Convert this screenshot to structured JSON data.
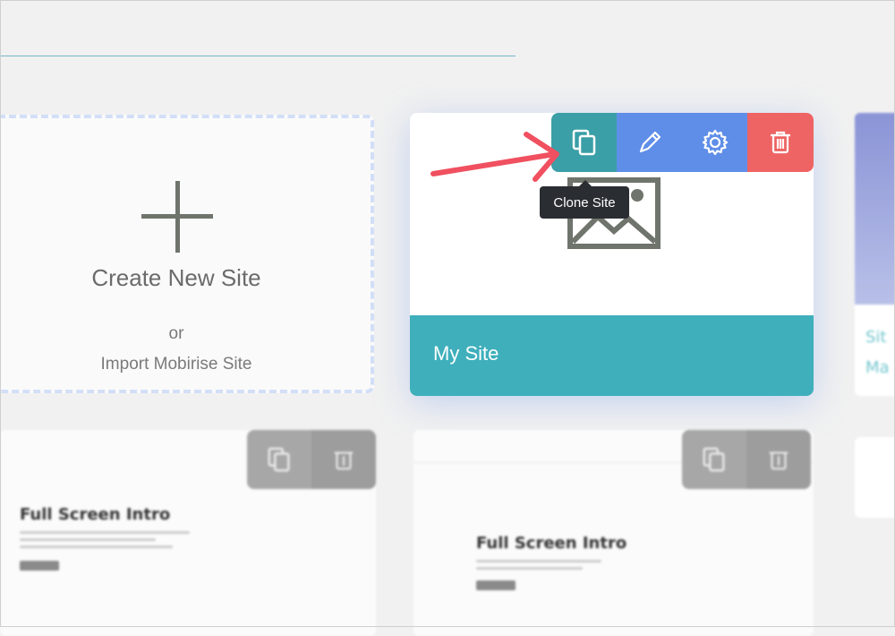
{
  "create_card": {
    "title": "Create New Site",
    "or_text": "or",
    "import_label": "Import Mobirise Site"
  },
  "site_card": {
    "name": "My Site",
    "toolbar": [
      "clone-icon",
      "edit-icon",
      "settings-icon",
      "delete-icon"
    ],
    "tooltip": "Clone Site"
  },
  "bottom_cards": [
    {
      "title": "Full Screen Intro"
    },
    {
      "title": "Full Screen Intro"
    }
  ],
  "right_card": {
    "text_line_1": "Sit",
    "text_line_2": "Ma"
  },
  "colors": {
    "accent_teal": "#3fafbc",
    "clone_button": "#3a9fa6",
    "edit_button": "#5f8ee8",
    "delete_button": "#ee6464",
    "arrow": "#f0505f",
    "tooltip_bg": "#2a2d32"
  }
}
